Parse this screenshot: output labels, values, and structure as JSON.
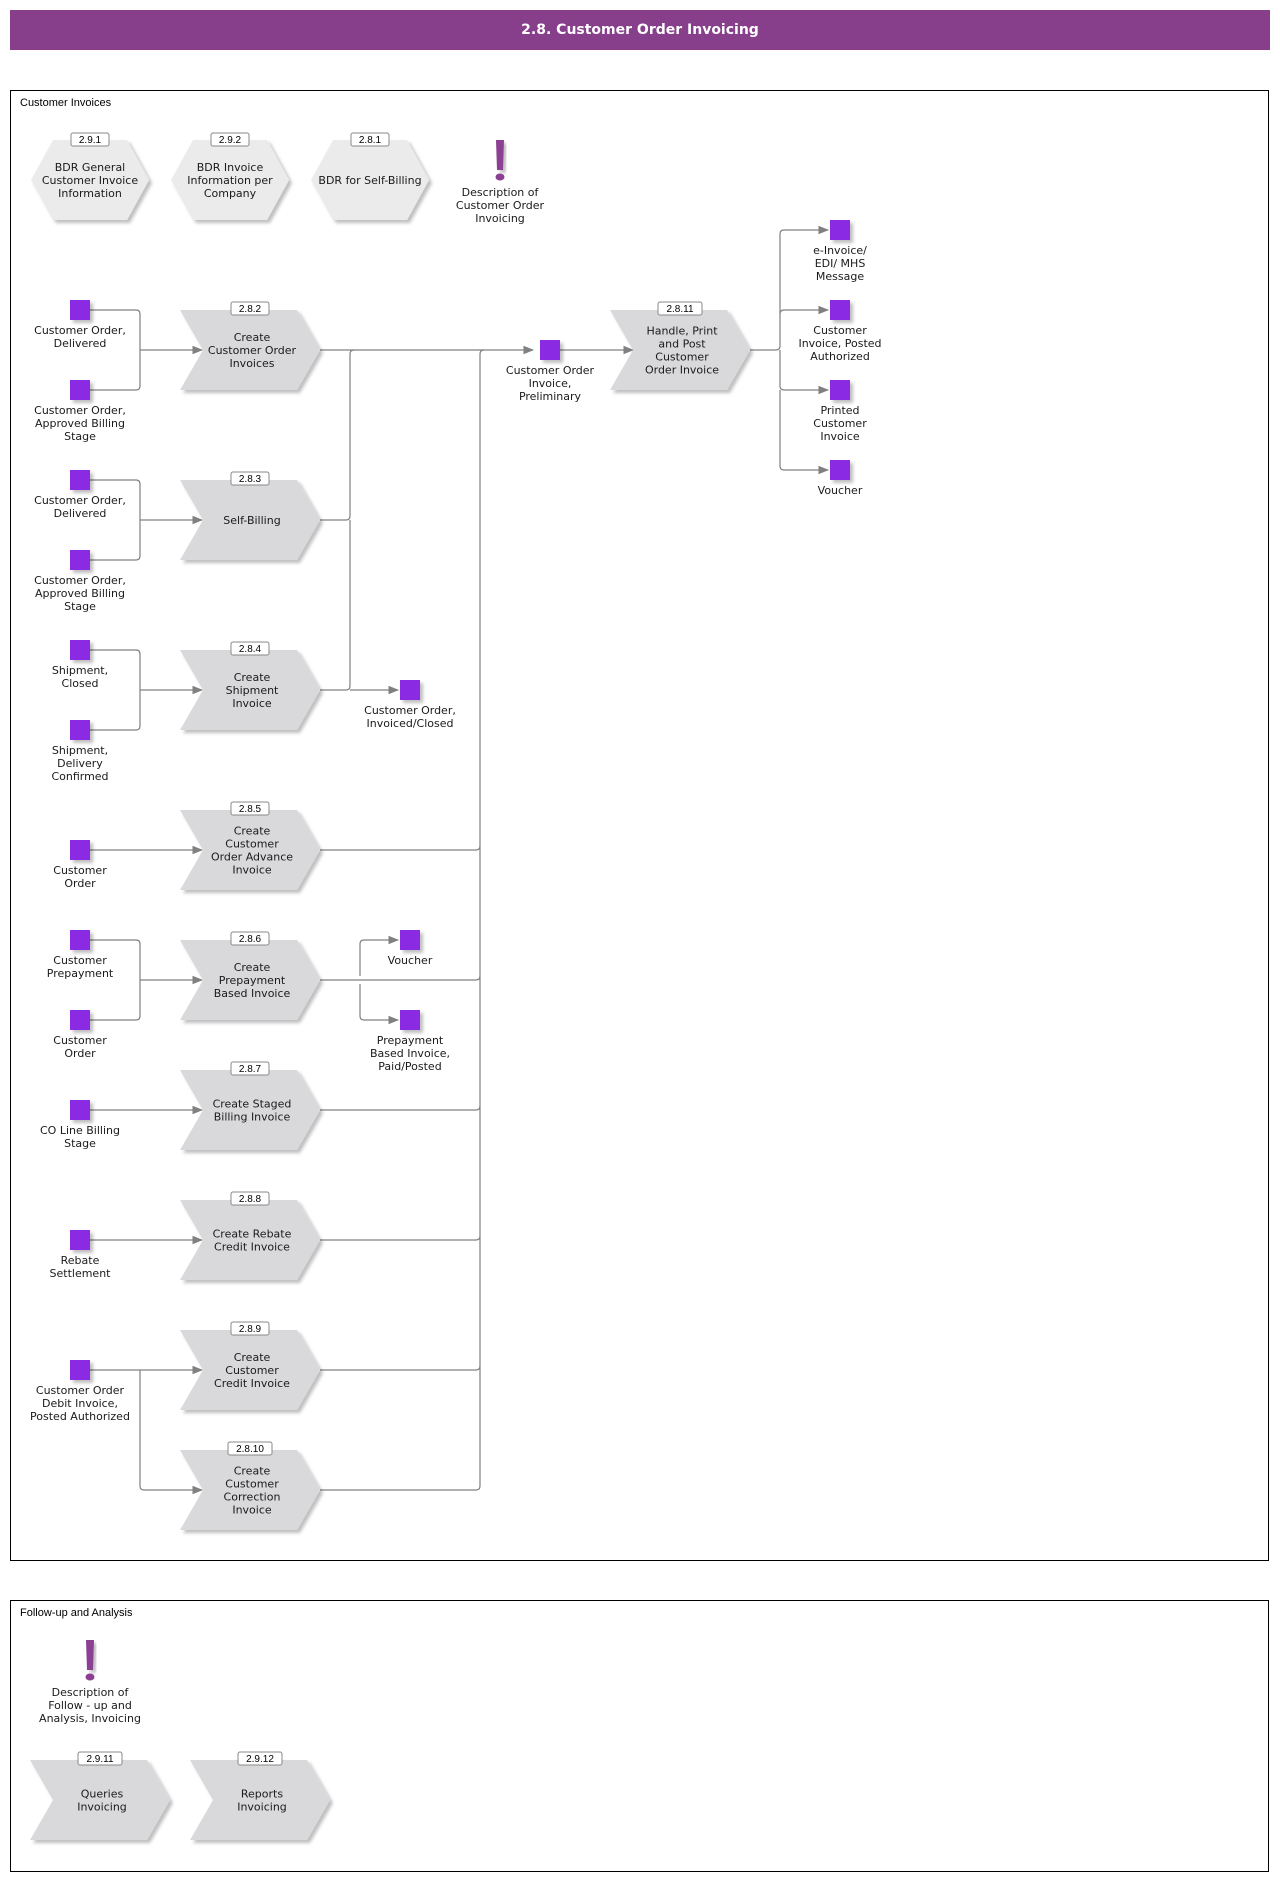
{
  "header": {
    "title": "2.8. Customer Order Invoicing"
  },
  "colors": {
    "header_bg": "#873f8c",
    "event": "#8a2be2",
    "process_fill": "#d9d9db",
    "hexagon_fill": "#ebebeb",
    "connector": "#808080",
    "exclamation": "#8b3f93"
  },
  "lanes": [
    {
      "id": "lane1",
      "title": "Customer Invoices"
    },
    {
      "id": "lane2",
      "title": "Follow-up and Analysis"
    }
  ],
  "hexagons": [
    {
      "id": "h291",
      "tag": "2.9.1",
      "lines": [
        "BDR General",
        "Customer Invoice",
        "Information"
      ]
    },
    {
      "id": "h292",
      "tag": "2.9.2",
      "lines": [
        "BDR Invoice",
        "Information per",
        "Company"
      ]
    },
    {
      "id": "h281",
      "tag": "2.8.1",
      "lines": [
        "BDR for Self-Billing"
      ]
    }
  ],
  "descriptions": [
    {
      "id": "d1",
      "icon": "exclamation-icon",
      "lines": [
        "Description of",
        "Customer Order",
        "Invoicing"
      ]
    },
    {
      "id": "d2",
      "icon": "exclamation-icon",
      "lines": [
        "Description of",
        "Follow - up and",
        "Analysis, Invoicing"
      ]
    }
  ],
  "processes": [
    {
      "id": "p282",
      "tag": "2.8.2",
      "lines": [
        "Create",
        "Customer Order",
        "Invoices"
      ]
    },
    {
      "id": "p283",
      "tag": "2.8.3",
      "lines": [
        "Self-Billing"
      ]
    },
    {
      "id": "p284",
      "tag": "2.8.4",
      "lines": [
        "Create",
        "Shipment",
        "Invoice"
      ]
    },
    {
      "id": "p285",
      "tag": "2.8.5",
      "lines": [
        "Create",
        "Customer",
        "Order Advance",
        "Invoice"
      ]
    },
    {
      "id": "p286",
      "tag": "2.8.6",
      "lines": [
        "Create",
        "Prepayment",
        "Based Invoice"
      ]
    },
    {
      "id": "p287",
      "tag": "2.8.7",
      "lines": [
        "Create Staged",
        "Billing Invoice"
      ]
    },
    {
      "id": "p288",
      "tag": "2.8.8",
      "lines": [
        "Create Rebate",
        "Credit Invoice"
      ]
    },
    {
      "id": "p289",
      "tag": "2.8.9",
      "lines": [
        "Create",
        "Customer",
        "Credit Invoice"
      ]
    },
    {
      "id": "p2810",
      "tag": "2.8.10",
      "lines": [
        "Create",
        "Customer",
        "Correction",
        "Invoice"
      ]
    },
    {
      "id": "p2811",
      "tag": "2.8.11",
      "lines": [
        "Handle, Print",
        "and Post",
        "Customer",
        "Order Invoice"
      ]
    },
    {
      "id": "p2911",
      "tag": "2.9.11",
      "lines": [
        "Queries",
        "Invoicing"
      ]
    },
    {
      "id": "p2912",
      "tag": "2.9.12",
      "lines": [
        "Reports",
        "Invoicing"
      ]
    }
  ],
  "events": [
    {
      "id": "e1",
      "lines": [
        "Customer Order,",
        "Delivered"
      ]
    },
    {
      "id": "e2",
      "lines": [
        "Customer Order,",
        "Approved Billing",
        "Stage"
      ]
    },
    {
      "id": "e3",
      "lines": [
        "Customer Order,",
        "Delivered"
      ]
    },
    {
      "id": "e4",
      "lines": [
        "Customer Order,",
        "Approved Billing",
        "Stage"
      ]
    },
    {
      "id": "e5",
      "lines": [
        "Shipment,",
        "Closed"
      ]
    },
    {
      "id": "e6",
      "lines": [
        "Shipment,",
        "Delivery",
        "Confirmed"
      ]
    },
    {
      "id": "e7",
      "lines": [
        "Customer",
        "Order"
      ]
    },
    {
      "id": "e8",
      "lines": [
        "Customer",
        "Prepayment"
      ]
    },
    {
      "id": "e9",
      "lines": [
        "Customer",
        "Order"
      ]
    },
    {
      "id": "e10",
      "lines": [
        "CO Line Billing",
        "Stage"
      ]
    },
    {
      "id": "e11",
      "lines": [
        "Rebate",
        "Settlement"
      ]
    },
    {
      "id": "e12",
      "lines": [
        "Customer Order",
        "Debit Invoice,",
        "Posted Authorized"
      ]
    },
    {
      "id": "e13",
      "lines": [
        "Customer Order,",
        "Invoiced/Closed"
      ]
    },
    {
      "id": "e14",
      "lines": [
        "Voucher"
      ]
    },
    {
      "id": "e15",
      "lines": [
        "Prepayment",
        "Based Invoice,",
        "Paid/Posted"
      ]
    },
    {
      "id": "e16",
      "lines": [
        "Customer Order",
        "Invoice,",
        "Preliminary"
      ]
    },
    {
      "id": "e17",
      "lines": [
        "e-Invoice/",
        "EDI/ MHS",
        "Message"
      ]
    },
    {
      "id": "e18",
      "lines": [
        "Customer",
        "Invoice, Posted",
        "Authorized"
      ]
    },
    {
      "id": "e19",
      "lines": [
        "Printed",
        "Customer",
        "Invoice"
      ]
    },
    {
      "id": "e20",
      "lines": [
        "Voucher"
      ]
    }
  ]
}
